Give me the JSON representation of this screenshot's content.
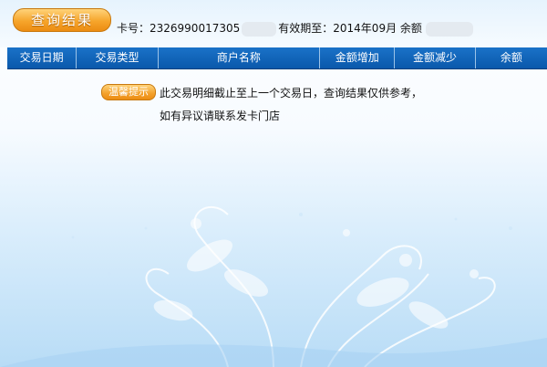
{
  "title": "查询结果",
  "card": {
    "label": "卡号：2326990017305",
    "valid_label": "有效期至：2014年09月",
    "balance_label": "余额"
  },
  "table": {
    "columns": [
      "交易日期",
      "交易类型",
      "商户名称",
      "金额增加",
      "金额减少",
      "余额"
    ]
  },
  "tip": {
    "badge": "温馨提示",
    "line1": "此交易明细截止至上一个交易日，查询结果仅供参考，",
    "line2": "如有异议请联系发卡门店"
  },
  "colors": {
    "header_blue": "#0a58ab",
    "accent_orange": "#f3a02a",
    "background_blue": "#b8dcf6"
  }
}
